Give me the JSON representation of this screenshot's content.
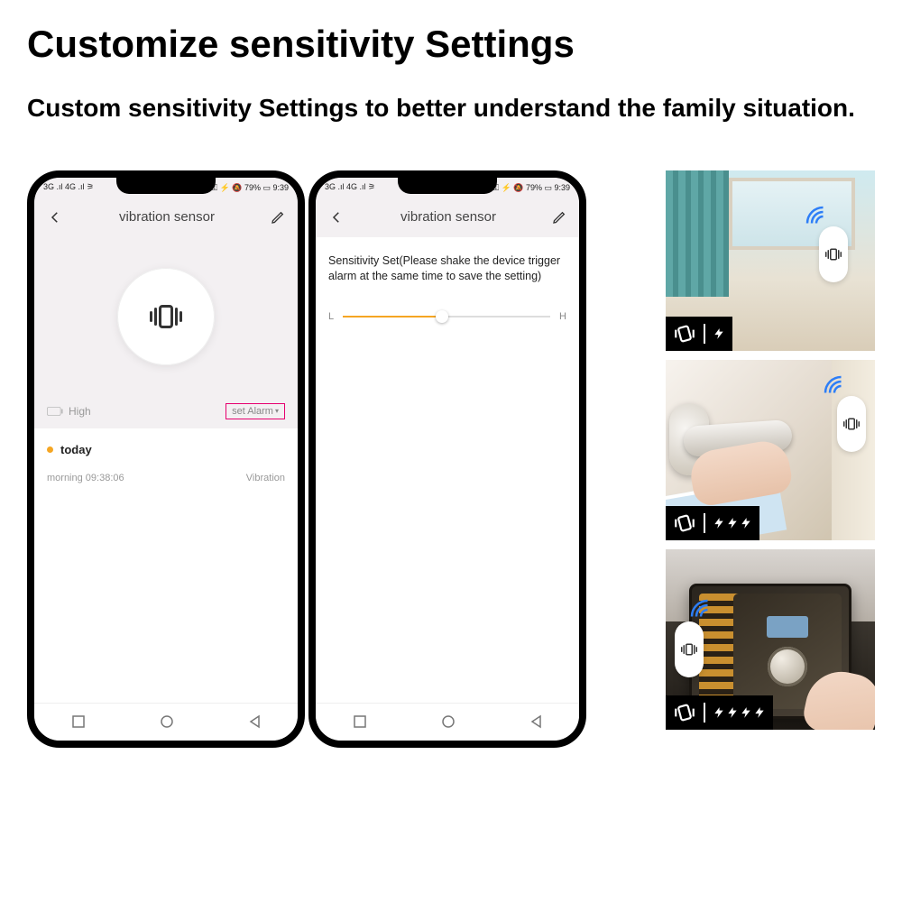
{
  "heading": "Customize sensitivity Settings",
  "subheading": "Custom sensitivity Settings to better understand the family situation.",
  "status": {
    "signal_left": "3G .ıl  4G .ıl  ⚞",
    "right": "ⓃⓃ ⚿ ⚡ 🔕 79% ▭ 9:39",
    "battery_pct": "79%",
    "time": "9:39"
  },
  "app": {
    "title": "vibration sensor"
  },
  "screen1": {
    "battery_label": "High",
    "set_alarm": "set Alarm",
    "today_label": "today",
    "event_time_label": "morning  09:38:06",
    "event_type": "Vibration"
  },
  "screen2": {
    "sensitivity_text": "Sensitivity Set(Please shake the device trigger alarm at the same time to save the setting)",
    "low_label": "L",
    "high_label": "H",
    "slider_value_pct": 48
  },
  "thumbs": {
    "bolt_counts": [
      1,
      3,
      4
    ]
  }
}
